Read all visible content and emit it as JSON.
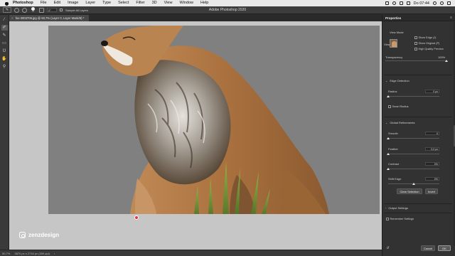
{
  "menubar": {
    "app_name": "Photoshop",
    "items": [
      "File",
      "Edit",
      "Image",
      "Layer",
      "Type",
      "Select",
      "Filter",
      "3D",
      "View",
      "Window",
      "Help"
    ],
    "clock": "Do 07:44",
    "status_icons": [
      "dropbox-icon",
      "wifi-icon",
      "volume-icon",
      "battery-icon",
      "spotlight-icon",
      "siri-icon",
      "list-icon"
    ]
  },
  "window_title": "Adobe Photoshop 2020",
  "options_bar": {
    "brush_size": "30",
    "angle_value": "0°",
    "sample_all_layers": "Sample All Layers"
  },
  "document_tab": {
    "label": "fox-3003706.jpg @ 50,7% (Layer 0, Layer Mask/8) *",
    "close": "×"
  },
  "status_bar": {
    "zoom": "50,7%",
    "doc_size": "3870 px x 2716 px (300 ppi)",
    "arrow": "›"
  },
  "watermark": {
    "text": "zenzdesign"
  },
  "properties": {
    "title": "Properties",
    "view_mode_label": "View Mode",
    "view_label": "View:",
    "show_edge": "Show Edge (J)",
    "show_original": "Show Original (P)",
    "high_quality_preview": "High Quality Preview",
    "transparency_label": "Transparency",
    "transparency_value": "100%",
    "transparency_level": 1.0,
    "edge_detection": {
      "title": "Edge Detection",
      "radius_label": "Radius",
      "radius_value": "0 px",
      "radius_level": 0.0,
      "smart_radius": "Smart Radius"
    },
    "global_refinements": {
      "title": "Global Refinements",
      "smooth_label": "Smooth",
      "smooth_value": "0",
      "smooth_level": 0.0,
      "feather_label": "Feather",
      "feather_value": "0,0 px",
      "feather_level": 0.0,
      "contrast_label": "Contrast",
      "contrast_value": "0%",
      "contrast_level": 0.0,
      "shift_edge_label": "Shift Edge",
      "shift_edge_value": "0%",
      "shift_edge_level": 0.5,
      "clear_selection": "Clear Selection",
      "invert": "Invert"
    },
    "output_settings": "Output Settings",
    "remember_settings": "Remember Settings",
    "cancel": "Cancel",
    "ok": "OK"
  },
  "colors": {
    "canvas_bg": "#c6c6c6",
    "document_gray": "#808080",
    "marker_red": "#e8324a"
  }
}
